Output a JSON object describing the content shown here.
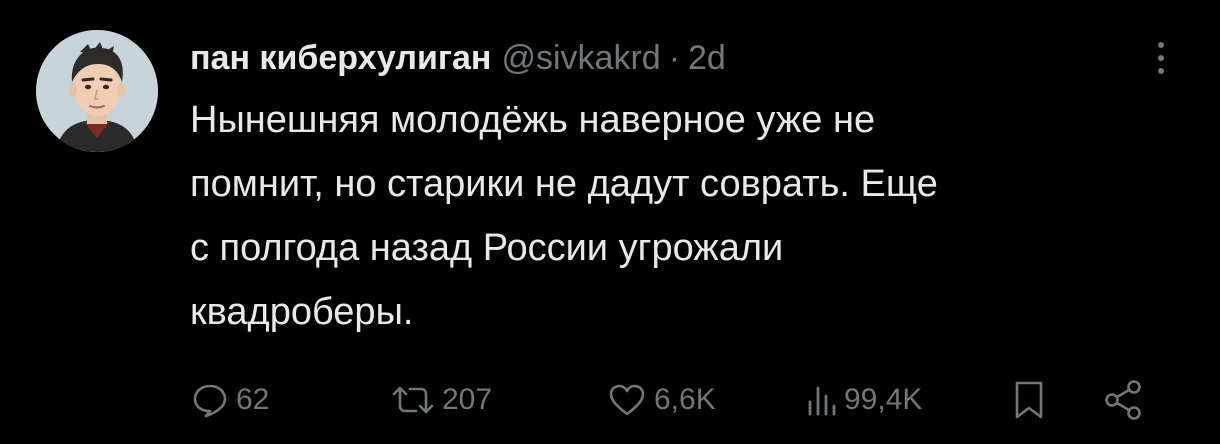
{
  "tweet": {
    "author_name": "пан киберхулиган",
    "handle": "@sivkakrd",
    "separator": "·",
    "time": "2d",
    "text": "Нынешняя молодёжь наверное уже не\nпомнит, но старики не дадут соврать. Еще\nс полгода назад России угрожали\nквадроберы."
  },
  "actions": {
    "replies": "62",
    "reposts": "207",
    "likes": "6,6K",
    "views": "99,4K"
  },
  "icons": {
    "reply": "reply-icon",
    "repost": "repost-icon",
    "like": "heart-icon",
    "views": "views-icon",
    "bookmark": "bookmark-icon",
    "share": "share-icon",
    "more": "more-icon"
  },
  "colors": {
    "background": "#000000",
    "text": "#e7e9ea",
    "muted": "#71767b"
  }
}
